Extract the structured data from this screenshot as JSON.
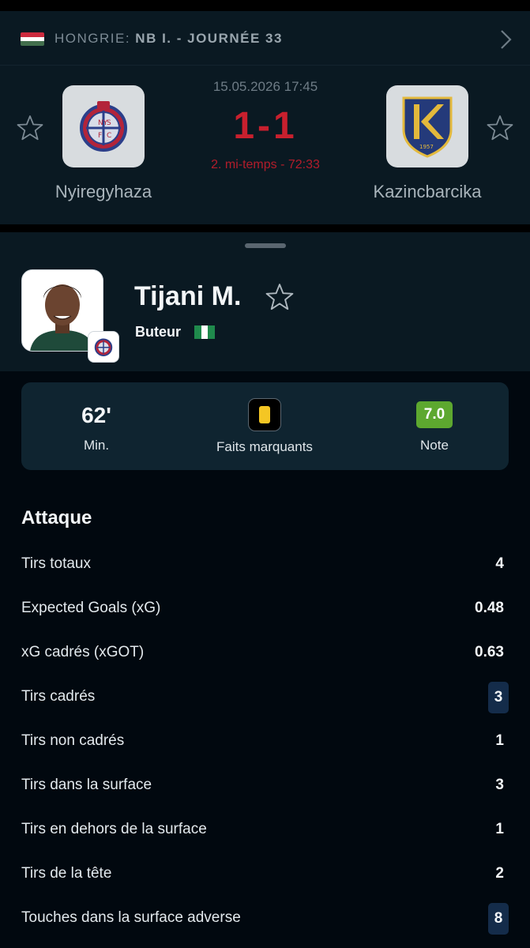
{
  "match": {
    "league_country": "HONGRIE:",
    "league_name": "NB I. - JOURNÉE 33",
    "date": "15.05.2026 17:45",
    "score": "1-1",
    "status": "2. mi-temps - 72:33",
    "home_team": "Nyiregyhaza",
    "away_team": "Kazincbarcika",
    "colors": {
      "score": "#c8202e",
      "flag_hu": [
        "#cd2a3e",
        "#ffffff",
        "#436f4d"
      ]
    }
  },
  "player": {
    "name": "Tijani M.",
    "role": "Buteur",
    "nationality_flag": "nigeria-flag"
  },
  "summary": {
    "minutes_value": "62'",
    "minutes_label": "Min.",
    "highlights_label": "Faits marquants",
    "rating_value": "7.0",
    "rating_label": "Note",
    "rating_color": "#5da82f"
  },
  "section": {
    "title": "Attaque"
  },
  "stats": [
    {
      "label": "Tirs totaux",
      "value": "4",
      "highlight": false
    },
    {
      "label": "Expected Goals (xG)",
      "value": "0.48",
      "highlight": false
    },
    {
      "label": "xG cadrés (xGOT)",
      "value": "0.63",
      "highlight": false
    },
    {
      "label": "Tirs cadrés",
      "value": "3",
      "highlight": true
    },
    {
      "label": "Tirs non cadrés",
      "value": "1",
      "highlight": false
    },
    {
      "label": "Tirs dans la surface",
      "value": "3",
      "highlight": false
    },
    {
      "label": "Tirs en dehors de la surface",
      "value": "1",
      "highlight": false
    },
    {
      "label": "Tirs de la tête",
      "value": "2",
      "highlight": false
    },
    {
      "label": "Touches dans la surface adverse",
      "value": "8",
      "highlight": true
    }
  ]
}
